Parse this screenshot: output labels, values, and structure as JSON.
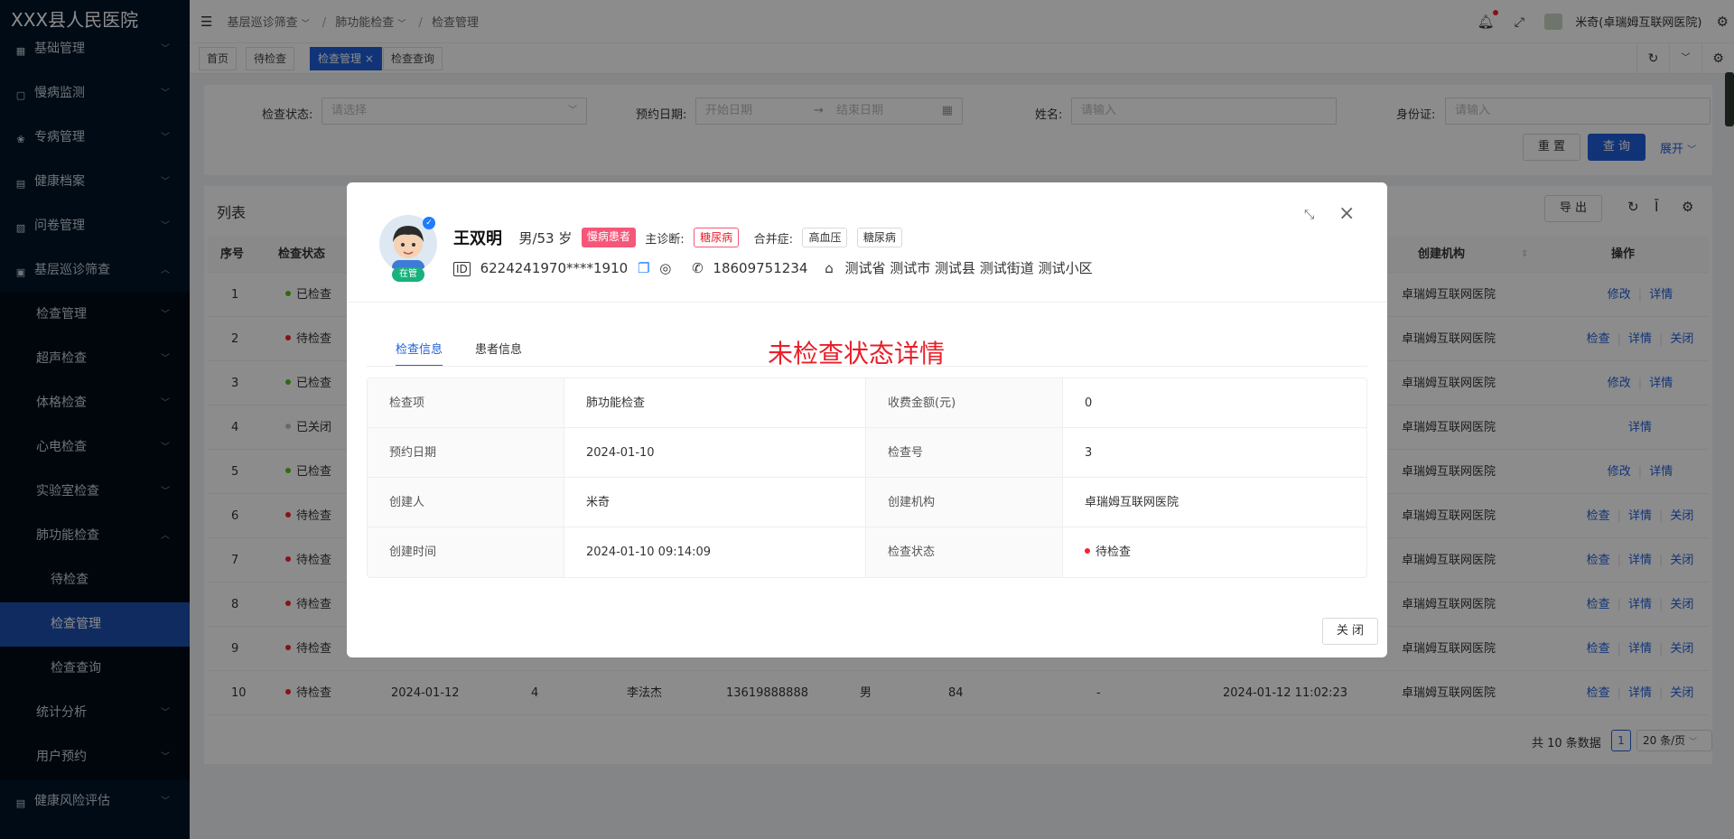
{
  "app": {
    "hospital_name": "XXX县人民医院"
  },
  "sidebar": {
    "items": [
      {
        "label": "基础管理",
        "icon": "grid-icon"
      },
      {
        "label": "慢病监测",
        "icon": "monitor-icon"
      },
      {
        "label": "专病管理",
        "icon": "medal-icon"
      },
      {
        "label": "健康档案",
        "icon": "file-icon"
      },
      {
        "label": "问卷管理",
        "icon": "survey-icon"
      },
      {
        "label": "基层巡诊筛查",
        "icon": "clipboard-icon"
      },
      {
        "label": "检查管理"
      },
      {
        "label": "超声检查"
      },
      {
        "label": "体格检查"
      },
      {
        "label": "心电检查"
      },
      {
        "label": "实验室检查"
      },
      {
        "label": "肺功能检查"
      },
      {
        "label": "待检查"
      },
      {
        "label": "检查管理"
      },
      {
        "label": "检查查询"
      },
      {
        "label": "统计分析"
      },
      {
        "label": "用户预约"
      },
      {
        "label": "健康风险评估",
        "icon": "assessment-icon"
      }
    ]
  },
  "topbar": {
    "breadcrumb": [
      "基层巡诊筛查",
      "肺功能检查",
      "检查管理"
    ],
    "user": "米奇(卓瑞姆互联网医院)"
  },
  "tabs": [
    "首页",
    "待检查",
    "检查管理",
    "检查查询"
  ],
  "filters": {
    "status_label": "检查状态:",
    "status_placeholder": "请选择",
    "date_label": "预约日期:",
    "date_start": "开始日期",
    "date_end": "结束日期",
    "name_label": "姓名:",
    "name_placeholder": "请输入",
    "id_label": "身份证:",
    "id_placeholder": "请输入",
    "reset": "重 置",
    "search": "查 询",
    "expand": "展开"
  },
  "list": {
    "title": "列表",
    "export": "导 出",
    "headers": {
      "no": "序号",
      "status": "检查状态",
      "org": "创建机构",
      "ops": "操作"
    },
    "rows": [
      {
        "no": "1",
        "status": "已检查",
        "color": "#52c41a",
        "org": "卓瑞姆互联网医院",
        "ops": [
          "修改",
          "详情"
        ]
      },
      {
        "no": "2",
        "status": "待检查",
        "color": "#f5222d",
        "org": "卓瑞姆互联网医院",
        "ops": [
          "检查",
          "详情",
          "关闭"
        ]
      },
      {
        "no": "3",
        "status": "已检查",
        "color": "#52c41a",
        "org": "卓瑞姆互联网医院",
        "ops": [
          "修改",
          "详情"
        ]
      },
      {
        "no": "4",
        "status": "已关闭",
        "color": "#bfbfbf",
        "org": "卓瑞姆互联网医院",
        "ops": [
          "详情"
        ]
      },
      {
        "no": "5",
        "status": "已检查",
        "color": "#52c41a",
        "org": "卓瑞姆互联网医院",
        "ops": [
          "修改",
          "详情"
        ]
      },
      {
        "no": "6",
        "status": "待检查",
        "color": "#f5222d",
        "org": "卓瑞姆互联网医院",
        "ops": [
          "检查",
          "详情",
          "关闭"
        ]
      },
      {
        "no": "7",
        "status": "待检查",
        "color": "#f5222d",
        "org": "卓瑞姆互联网医院",
        "ops": [
          "检查",
          "详情",
          "关闭"
        ]
      },
      {
        "no": "8",
        "status": "待检查",
        "color": "#f5222d",
        "org": "卓瑞姆互联网医院",
        "ops": [
          "检查",
          "详情",
          "关闭"
        ]
      },
      {
        "no": "9",
        "status": "待检查",
        "color": "#f5222d",
        "org": "卓瑞姆互联网医院",
        "ops": [
          "检查",
          "详情",
          "关闭"
        ]
      },
      {
        "no": "10",
        "status": "待检查",
        "color": "#f5222d",
        "date": "2024-01-12",
        "exam_no": "4",
        "name": "李法杰",
        "phone": "13619888888",
        "gender": "男",
        "age": "84",
        "dash": "-",
        "created": "2024-01-12 11:02:23",
        "org": "卓瑞姆互联网医院",
        "ops": [
          "检查",
          "详情",
          "关闭"
        ]
      }
    ],
    "total": "共 10 条数据",
    "page": "1",
    "page_size": "20 条/页"
  },
  "modal": {
    "name": "王双明",
    "gender_age": "男/53 岁",
    "chronic_tag": "慢病患者",
    "main_diag_label": "主诊断:",
    "main_diag": "糖尿病",
    "comorbid_label": "合并症:",
    "comorbid": [
      "高血压",
      "糖尿病"
    ],
    "status_tag": "在管",
    "id_number": "6224241970****1910",
    "phone": "18609751234",
    "address": "测试省 测试市 测试县 测试街道 测试小区",
    "tabs": [
      "检查信息",
      "患者信息"
    ],
    "annotation": "未检查状态详情",
    "fields": [
      {
        "l1": "检查项",
        "v1": "肺功能检查",
        "l2": "收费金额(元)",
        "v2": "0"
      },
      {
        "l1": "预约日期",
        "v1": "2024-01-10",
        "l2": "检查号",
        "v2": "3"
      },
      {
        "l1": "创建人",
        "v1": "米奇",
        "l2": "创建机构",
        "v2": "卓瑞姆互联网医院"
      },
      {
        "l1": "创建时间",
        "v1": "2024-01-10 09:14:09",
        "l2": "检查状态",
        "v2": "待检查"
      }
    ],
    "close": "关 闭"
  },
  "colors": {
    "primary": "#1f5fdb",
    "sidebar": "#001529",
    "danger": "#f5222d",
    "success": "#52c41a",
    "annotation": "#e8202a"
  }
}
